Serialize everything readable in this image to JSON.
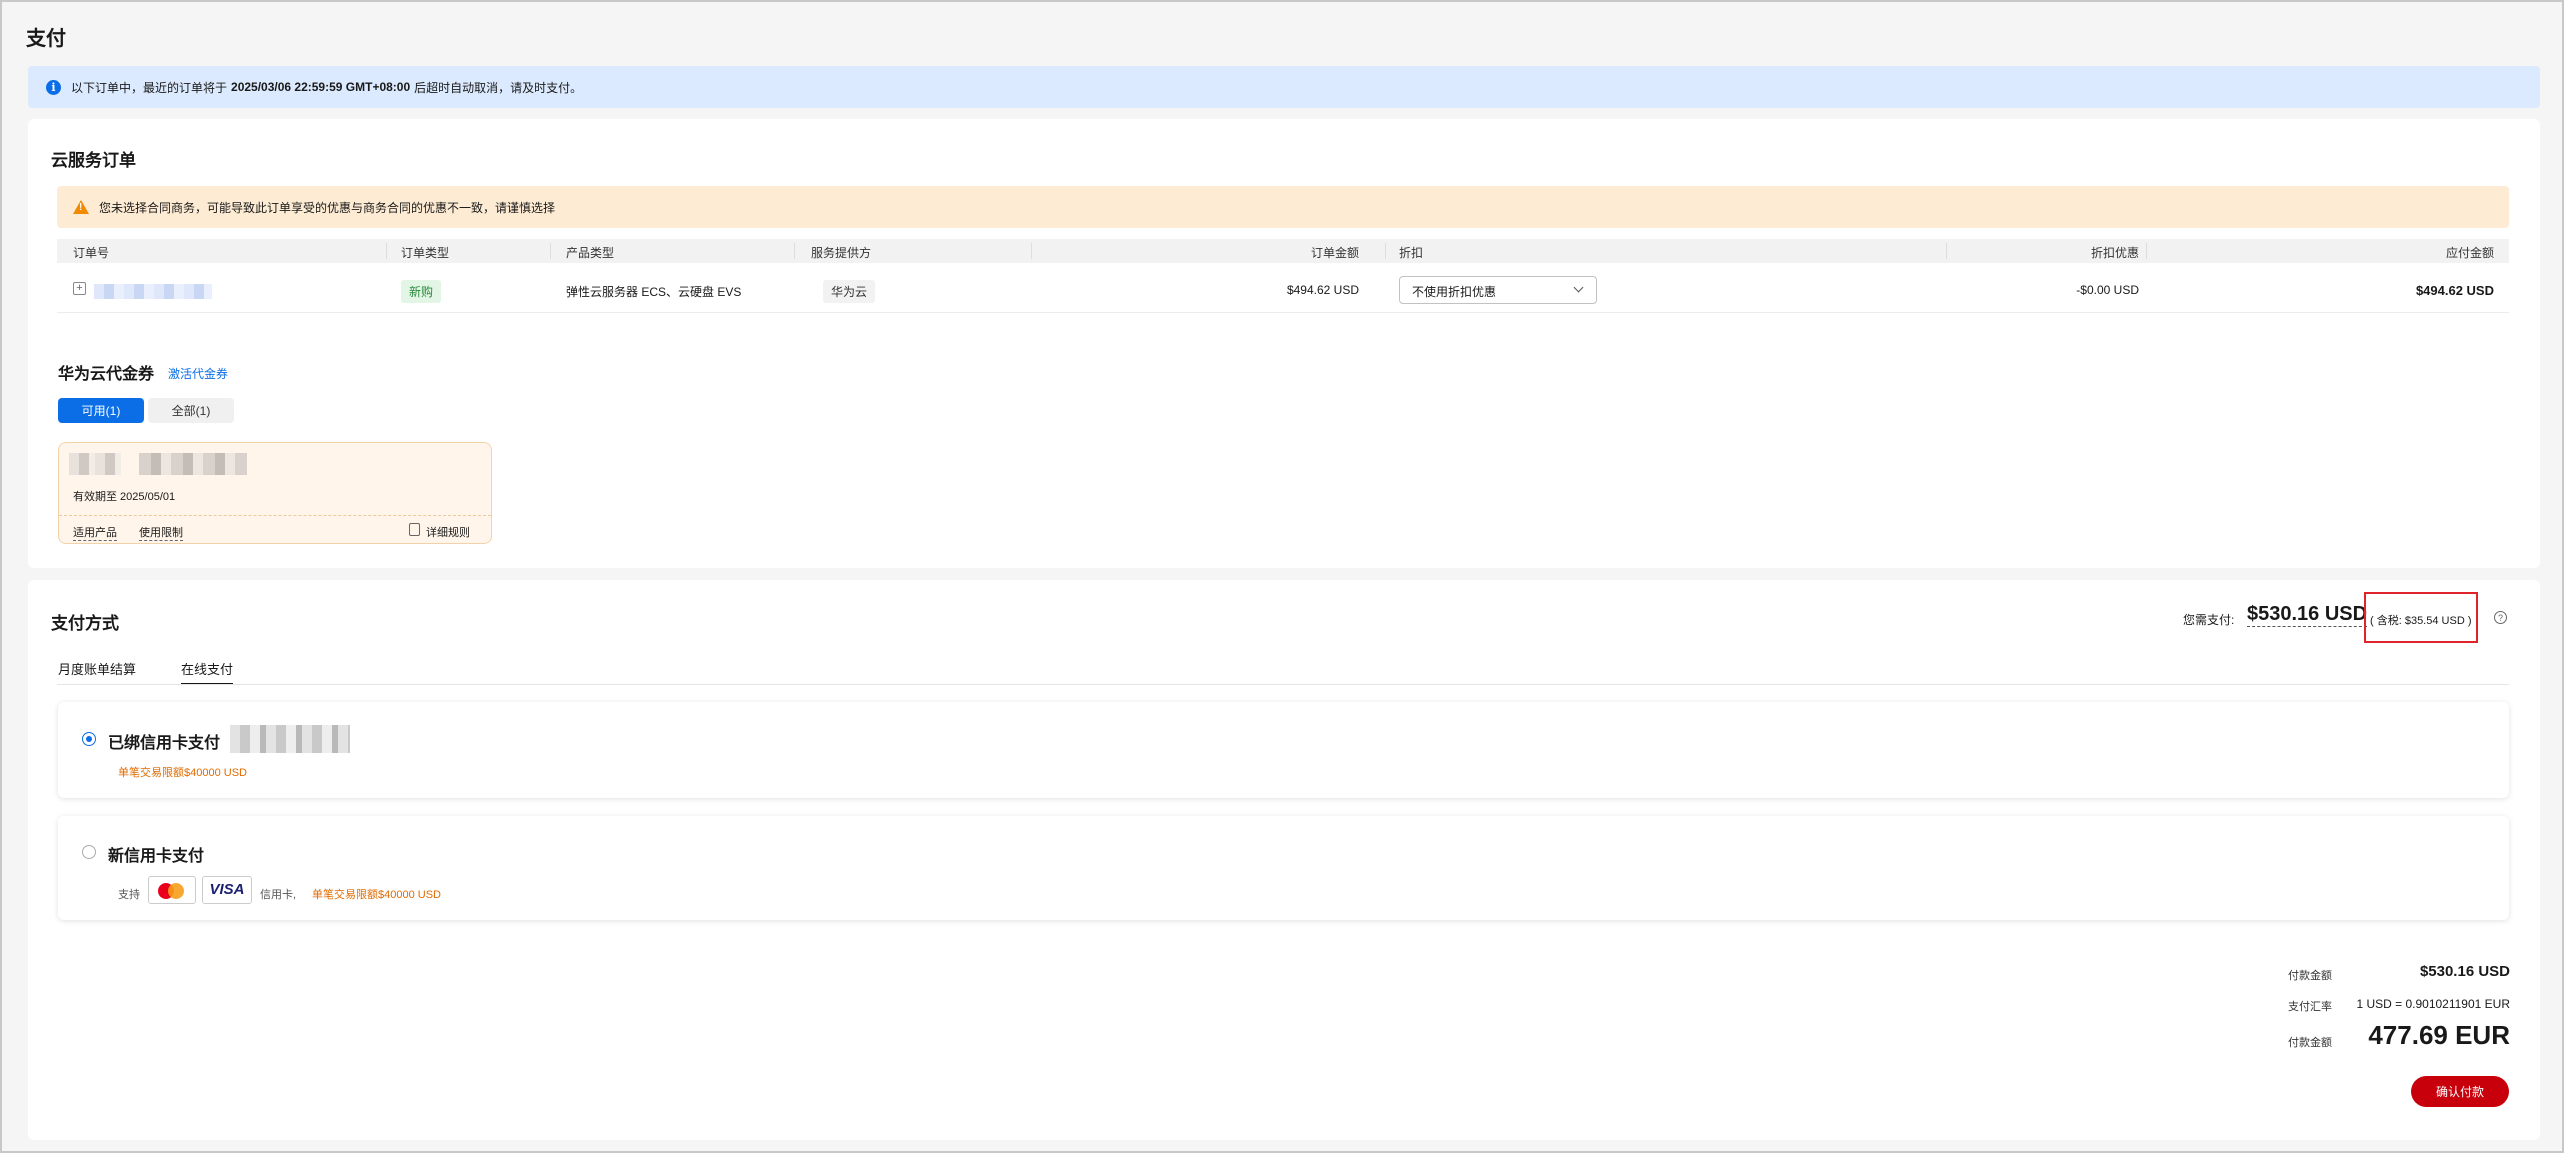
{
  "page": {
    "title": "支付"
  },
  "notice": {
    "prefix": "以下订单中，最近的订单将于",
    "deadline": "2025/03/06 22:59:59 GMT+08:00",
    "suffix": "后超时自动取消，请及时支付。"
  },
  "orders": {
    "title": "云服务订单",
    "warning": "您未选择合同商务，可能导致此订单享受的优惠与商务合同的优惠不一致，请谨慎选择",
    "columns": [
      "订单号",
      "订单类型",
      "产品类型",
      "服务提供方",
      "订单金额",
      "折扣",
      "折扣优惠",
      "应付金额"
    ],
    "row": {
      "type": "新购",
      "product": "弹性云服务器 ECS、云硬盘 EVS",
      "provider": "华为云",
      "amount": "$494.62 USD",
      "discount_select": "不使用折扣优惠",
      "discount_value": "-$0.00 USD",
      "payable": "$494.62 USD"
    }
  },
  "voucher": {
    "title": "华为云代金券",
    "activate_link": "激活代金券",
    "tab_available": "可用(1)",
    "tab_all": "全部(1)",
    "expiry": "有效期至 2025/05/01",
    "link_products": "适用产品",
    "link_limits": "使用限制",
    "rules": "详细规则"
  },
  "payment": {
    "title": "支付方式",
    "need_pay_label": "您需支付:",
    "need_pay_amount": "$530.16 USD",
    "tax_text": "( 含税: $35.54 USD )",
    "tabs": [
      "月度账单结算",
      "在线支付"
    ],
    "bound_card": {
      "title": "已绑信用卡支付",
      "limit": "单笔交易限额$40000 USD"
    },
    "new_card": {
      "title": "新信用卡支付",
      "support": "支持",
      "visa": "VISA",
      "credit": "信用卡,",
      "limit": "单笔交易限额$40000 USD"
    },
    "summary": {
      "amount_label": "付款金额",
      "amount_value": "$530.16 USD",
      "rate_label": "支付汇率",
      "rate_value": "1 USD = 0.9010211901 EUR",
      "final_label": "付款金额",
      "final_value": "477.69 EUR"
    },
    "confirm_button": "确认付款"
  },
  "colors": {
    "primary": "#0b6ee6",
    "brand_red": "#c7000b",
    "warning_orange": "#e06b00"
  }
}
